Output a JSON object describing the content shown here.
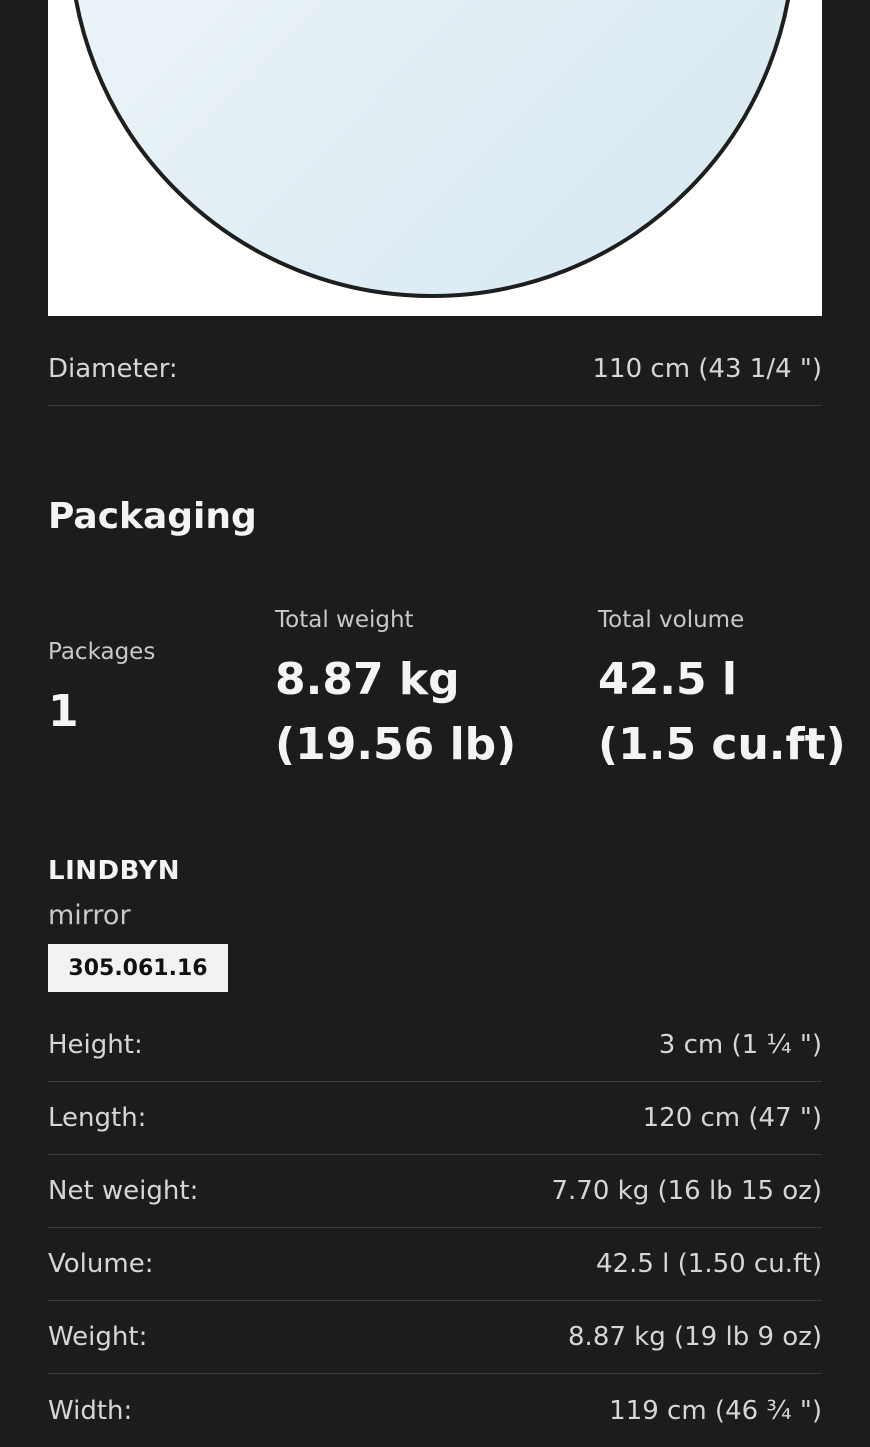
{
  "product_dimensions": {
    "diameter": {
      "label": "Diameter:",
      "value": "110 cm (43 1/4 \")"
    }
  },
  "packaging": {
    "title": "Packaging",
    "packages": {
      "label": "Packages",
      "value": "1"
    },
    "total_weight": {
      "label": "Total weight",
      "value_line1": "8.87 kg",
      "value_line2": "(19.56 lb)"
    },
    "total_volume": {
      "label": "Total volume",
      "value_line1": "42.5 l",
      "value_line2": "(1.5 cu.ft)"
    }
  },
  "package_item": {
    "name": "LINDBYN",
    "type": "mirror",
    "article_number": "305.061.16",
    "specs": [
      {
        "label": "Height:",
        "value": "3 cm (1 ¼ \")"
      },
      {
        "label": "Length:",
        "value": "120 cm (47 \")"
      },
      {
        "label": "Net weight:",
        "value": "7.70 kg (16 lb 15 oz)"
      },
      {
        "label": "Volume:",
        "value": "42.5 l (1.50 cu.ft)"
      },
      {
        "label": "Weight:",
        "value": "8.87 kg (19 lb 9 oz)"
      },
      {
        "label": "Width:",
        "value": "119 cm (46 ¾ \")"
      }
    ]
  }
}
